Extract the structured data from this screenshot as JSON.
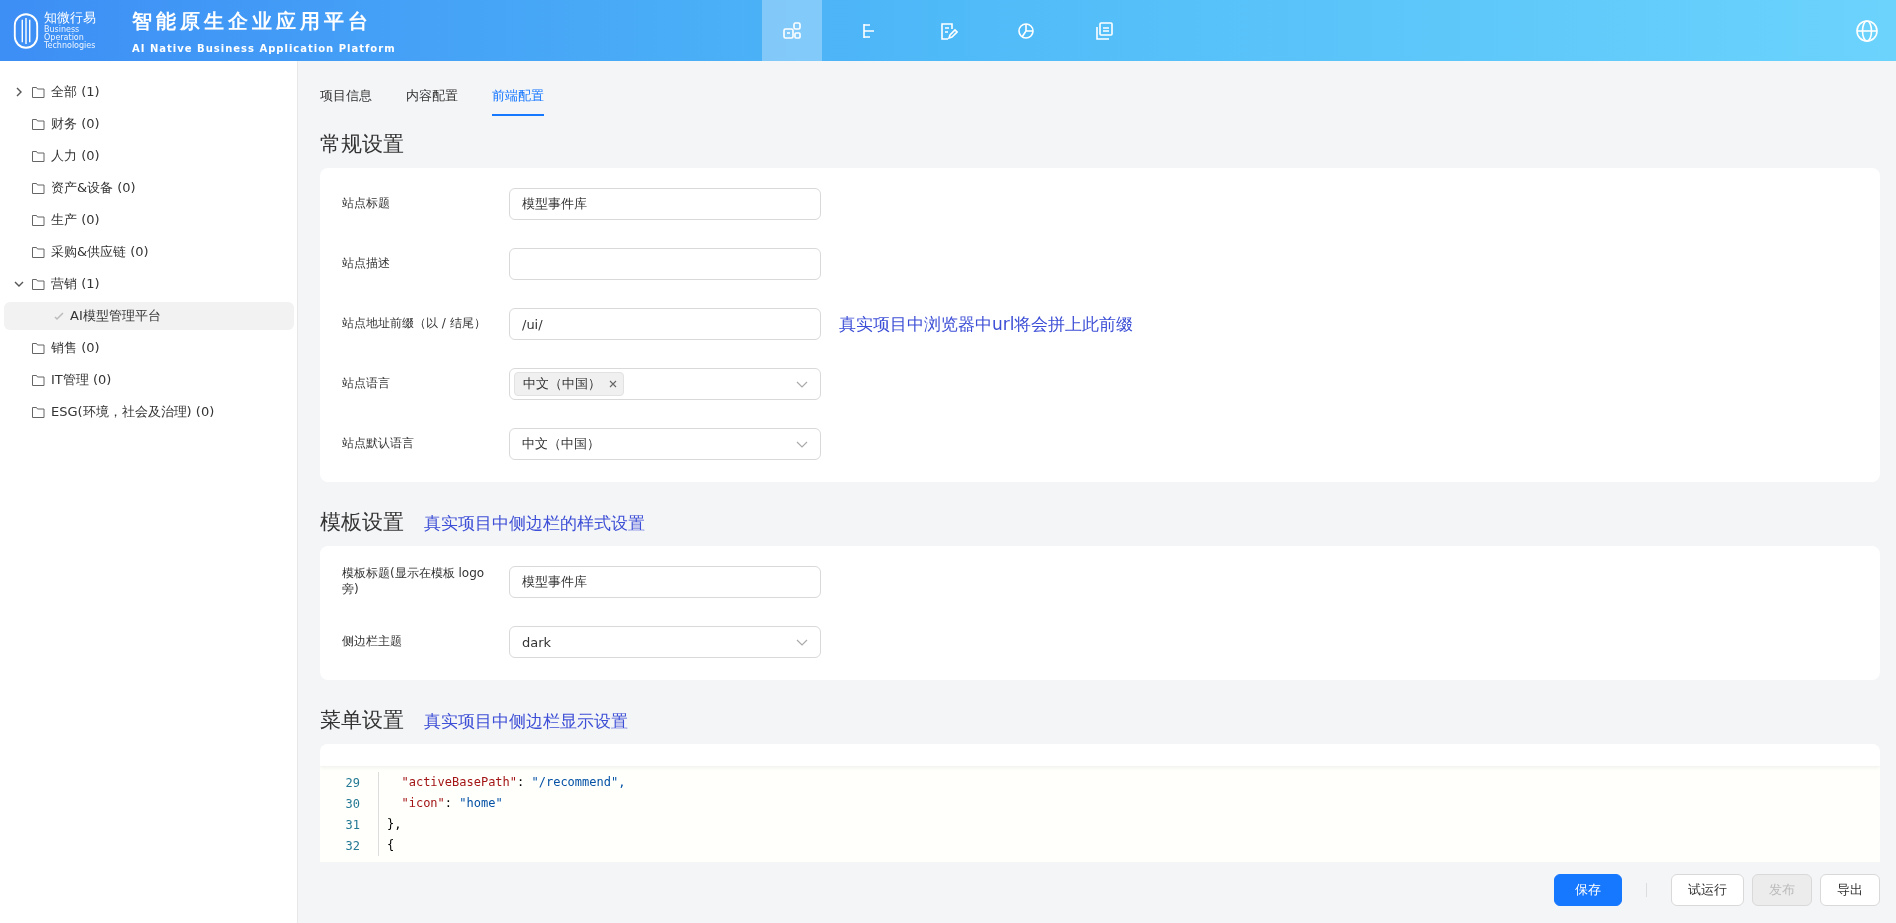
{
  "header": {
    "logo_name": "知微行易",
    "logo_sub": [
      "Business",
      "Operation",
      "Technologies"
    ],
    "title": "智能原生企业应用平台",
    "subtitle": "AI Native Business Application Platform",
    "nav": [
      {
        "kind": "modules",
        "selected": true
      },
      {
        "kind": "tree",
        "selected": false
      },
      {
        "kind": "edit",
        "selected": false
      },
      {
        "kind": "chart",
        "selected": false
      },
      {
        "kind": "sdk",
        "selected": false
      }
    ]
  },
  "sidebar": {
    "items": [
      {
        "label": "全部 (1)",
        "expanded": false,
        "selected": false
      },
      {
        "label": "财务 (0)",
        "selected": false
      },
      {
        "label": "人力 (0)",
        "selected": false
      },
      {
        "label": "资产&设备 (0)",
        "selected": false
      },
      {
        "label": "生产 (0)",
        "selected": false
      },
      {
        "label": "采购&供应链 (0)",
        "selected": false
      },
      {
        "label": "营销 (1)",
        "expanded": true,
        "selected": false,
        "children": [
          {
            "label": "AI模型管理平台",
            "selected": true
          }
        ]
      },
      {
        "label": "销售 (0)",
        "selected": false
      },
      {
        "label": "IT管理 (0)",
        "selected": false
      },
      {
        "label": "ESG(环境，社会及治理) (0)",
        "selected": false
      }
    ]
  },
  "tabs": [
    {
      "label": "项目信息",
      "selected": false
    },
    {
      "label": "内容配置",
      "selected": false
    },
    {
      "label": "前端配置",
      "selected": true
    }
  ],
  "general": {
    "title": "常规设置",
    "fields": [
      {
        "label": "站点标题",
        "kind": "text",
        "value": "模型事件库"
      },
      {
        "label": "站点描述",
        "kind": "text"
      },
      {
        "label": "站点地址前缀（以 / 结尾）",
        "kind": "text",
        "value": "/ui/",
        "hint": "真实项目中浏览器中url将会拼上此前缀"
      },
      {
        "label": "站点语言",
        "kind": "tags",
        "tags": [
          "中文（中国）"
        ]
      },
      {
        "label": "站点默认语言",
        "kind": "select",
        "value": "中文（中国）"
      }
    ]
  },
  "template": {
    "title": "模板设置",
    "hint": "真实项目中侧边栏的样式设置",
    "fields": [
      {
        "label": "模板标题(显示在模板 logo 旁)",
        "kind": "text",
        "value": "模型事件库"
      },
      {
        "label": "侧边栏主题",
        "kind": "select",
        "value": "dark"
      }
    ]
  },
  "menu": {
    "title": "菜单设置",
    "hint": "真实项目中侧边栏显示设置",
    "code": [
      {
        "num": "29",
        "text": "  \"activeBasePath\": \"/recommend\","
      },
      {
        "num": "30",
        "text": "  \"icon\": \"home\""
      },
      {
        "num": "31",
        "text": "},"
      },
      {
        "num": "32",
        "text": "{"
      }
    ]
  },
  "buttons": [
    {
      "label": "保存",
      "kind": "primary",
      "disabled": false
    },
    {
      "label": "试运行",
      "kind": "default",
      "disabled": false
    },
    {
      "label": "发布",
      "kind": "default",
      "disabled": true
    },
    {
      "label": "导出",
      "kind": "default",
      "disabled": false
    }
  ]
}
